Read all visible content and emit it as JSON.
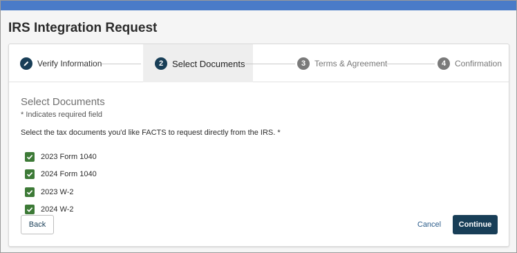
{
  "page": {
    "title": "IRS Integration Request"
  },
  "colors": {
    "header_bar": "#4a7bc8",
    "primary": "#183e57",
    "checkbox": "#3d7a37",
    "pending_step": "#7a7a7a"
  },
  "stepper": {
    "steps": [
      {
        "number": "",
        "label": "Verify Information",
        "status": "completed",
        "icon": "pencil-icon"
      },
      {
        "number": "2",
        "label": "Select Documents",
        "status": "current"
      },
      {
        "number": "3",
        "label": "Terms & Agreement",
        "status": "pending"
      },
      {
        "number": "4",
        "label": "Confirmation",
        "status": "pending"
      }
    ]
  },
  "section": {
    "title": "Select Documents",
    "required_note": "* Indicates required field",
    "instruction": "Select the tax documents you'd like FACTS to request directly from the IRS. *"
  },
  "documents": [
    {
      "label": "2023 Form 1040",
      "checked": true
    },
    {
      "label": "2024 Form 1040",
      "checked": true
    },
    {
      "label": "2023 W-2",
      "checked": true
    },
    {
      "label": "2024 W-2",
      "checked": true
    }
  ],
  "actions": {
    "back": "Back",
    "cancel": "Cancel",
    "continue": "Continue"
  }
}
